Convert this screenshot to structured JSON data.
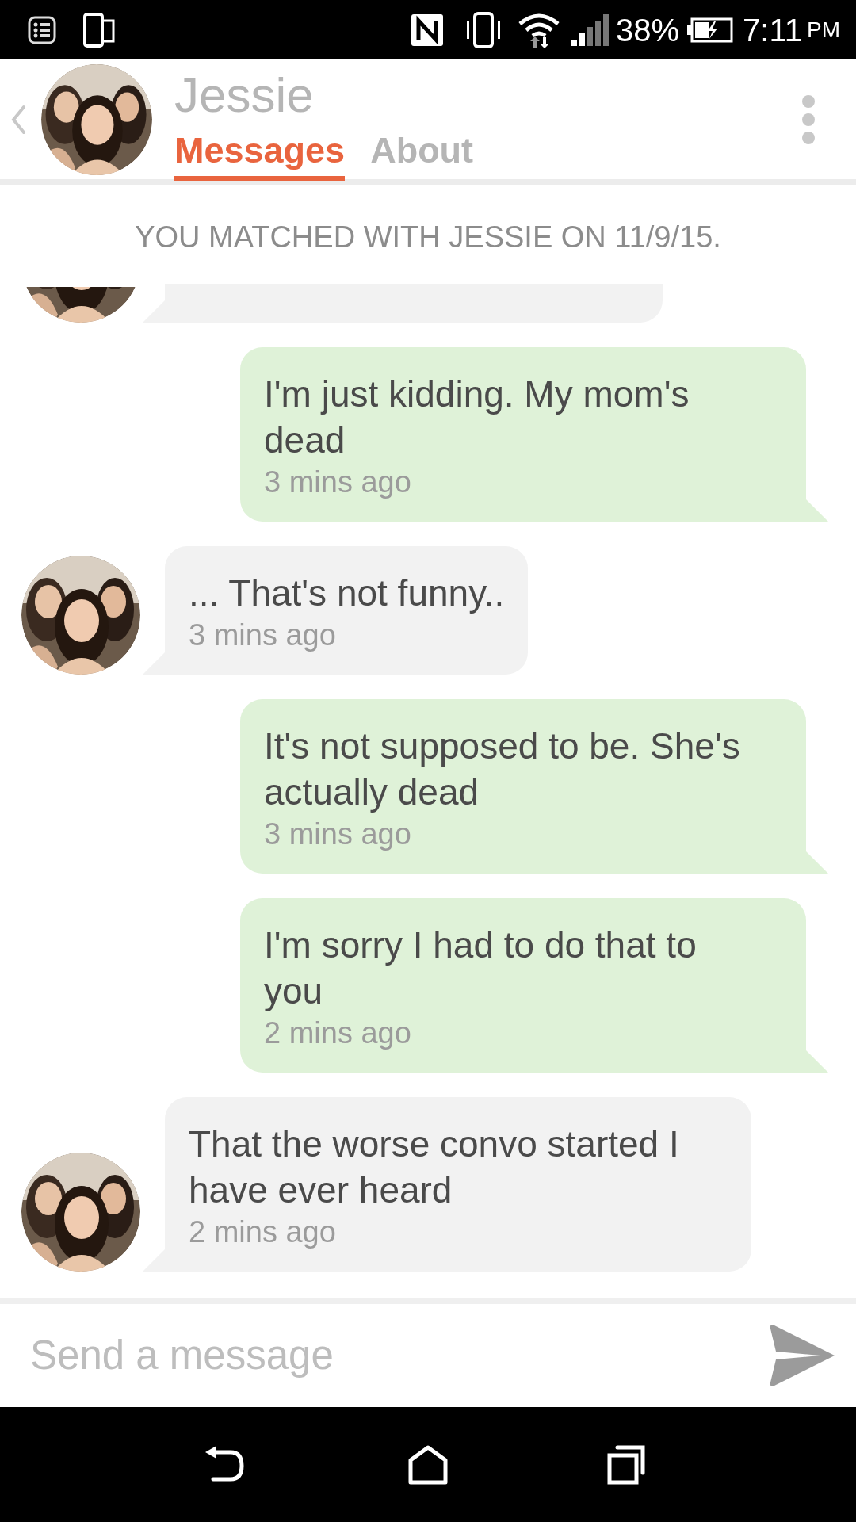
{
  "status_bar": {
    "battery": "38%",
    "time": "7:11",
    "meridiem": "PM"
  },
  "header": {
    "name": "Jessie",
    "tabs": [
      {
        "label": "Messages",
        "selected": true
      },
      {
        "label": "About",
        "selected": false
      }
    ]
  },
  "match_notice": "YOU MATCHED WITH JESSIE ON 11/9/15.",
  "messages": [
    {
      "kind": "received",
      "cut_off": true
    },
    {
      "kind": "sent",
      "cut_off": false,
      "text": "I'm just kidding. My mom's dead",
      "time": "3 mins ago"
    },
    {
      "kind": "received",
      "cut_off": false,
      "text": "... That's not funny..",
      "time": "3 mins ago"
    },
    {
      "kind": "sent",
      "cut_off": false,
      "text": "It's not supposed to be. She's actually dead",
      "time": "3 mins ago"
    },
    {
      "kind": "sent",
      "cut_off": false,
      "text": "I'm sorry I had to do that to you",
      "time": "2 mins ago"
    },
    {
      "kind": "received",
      "cut_off": false,
      "text": "That the worse convo started I have ever heard",
      "time": "2 mins ago"
    }
  ],
  "composer": {
    "placeholder": "Send a message"
  }
}
